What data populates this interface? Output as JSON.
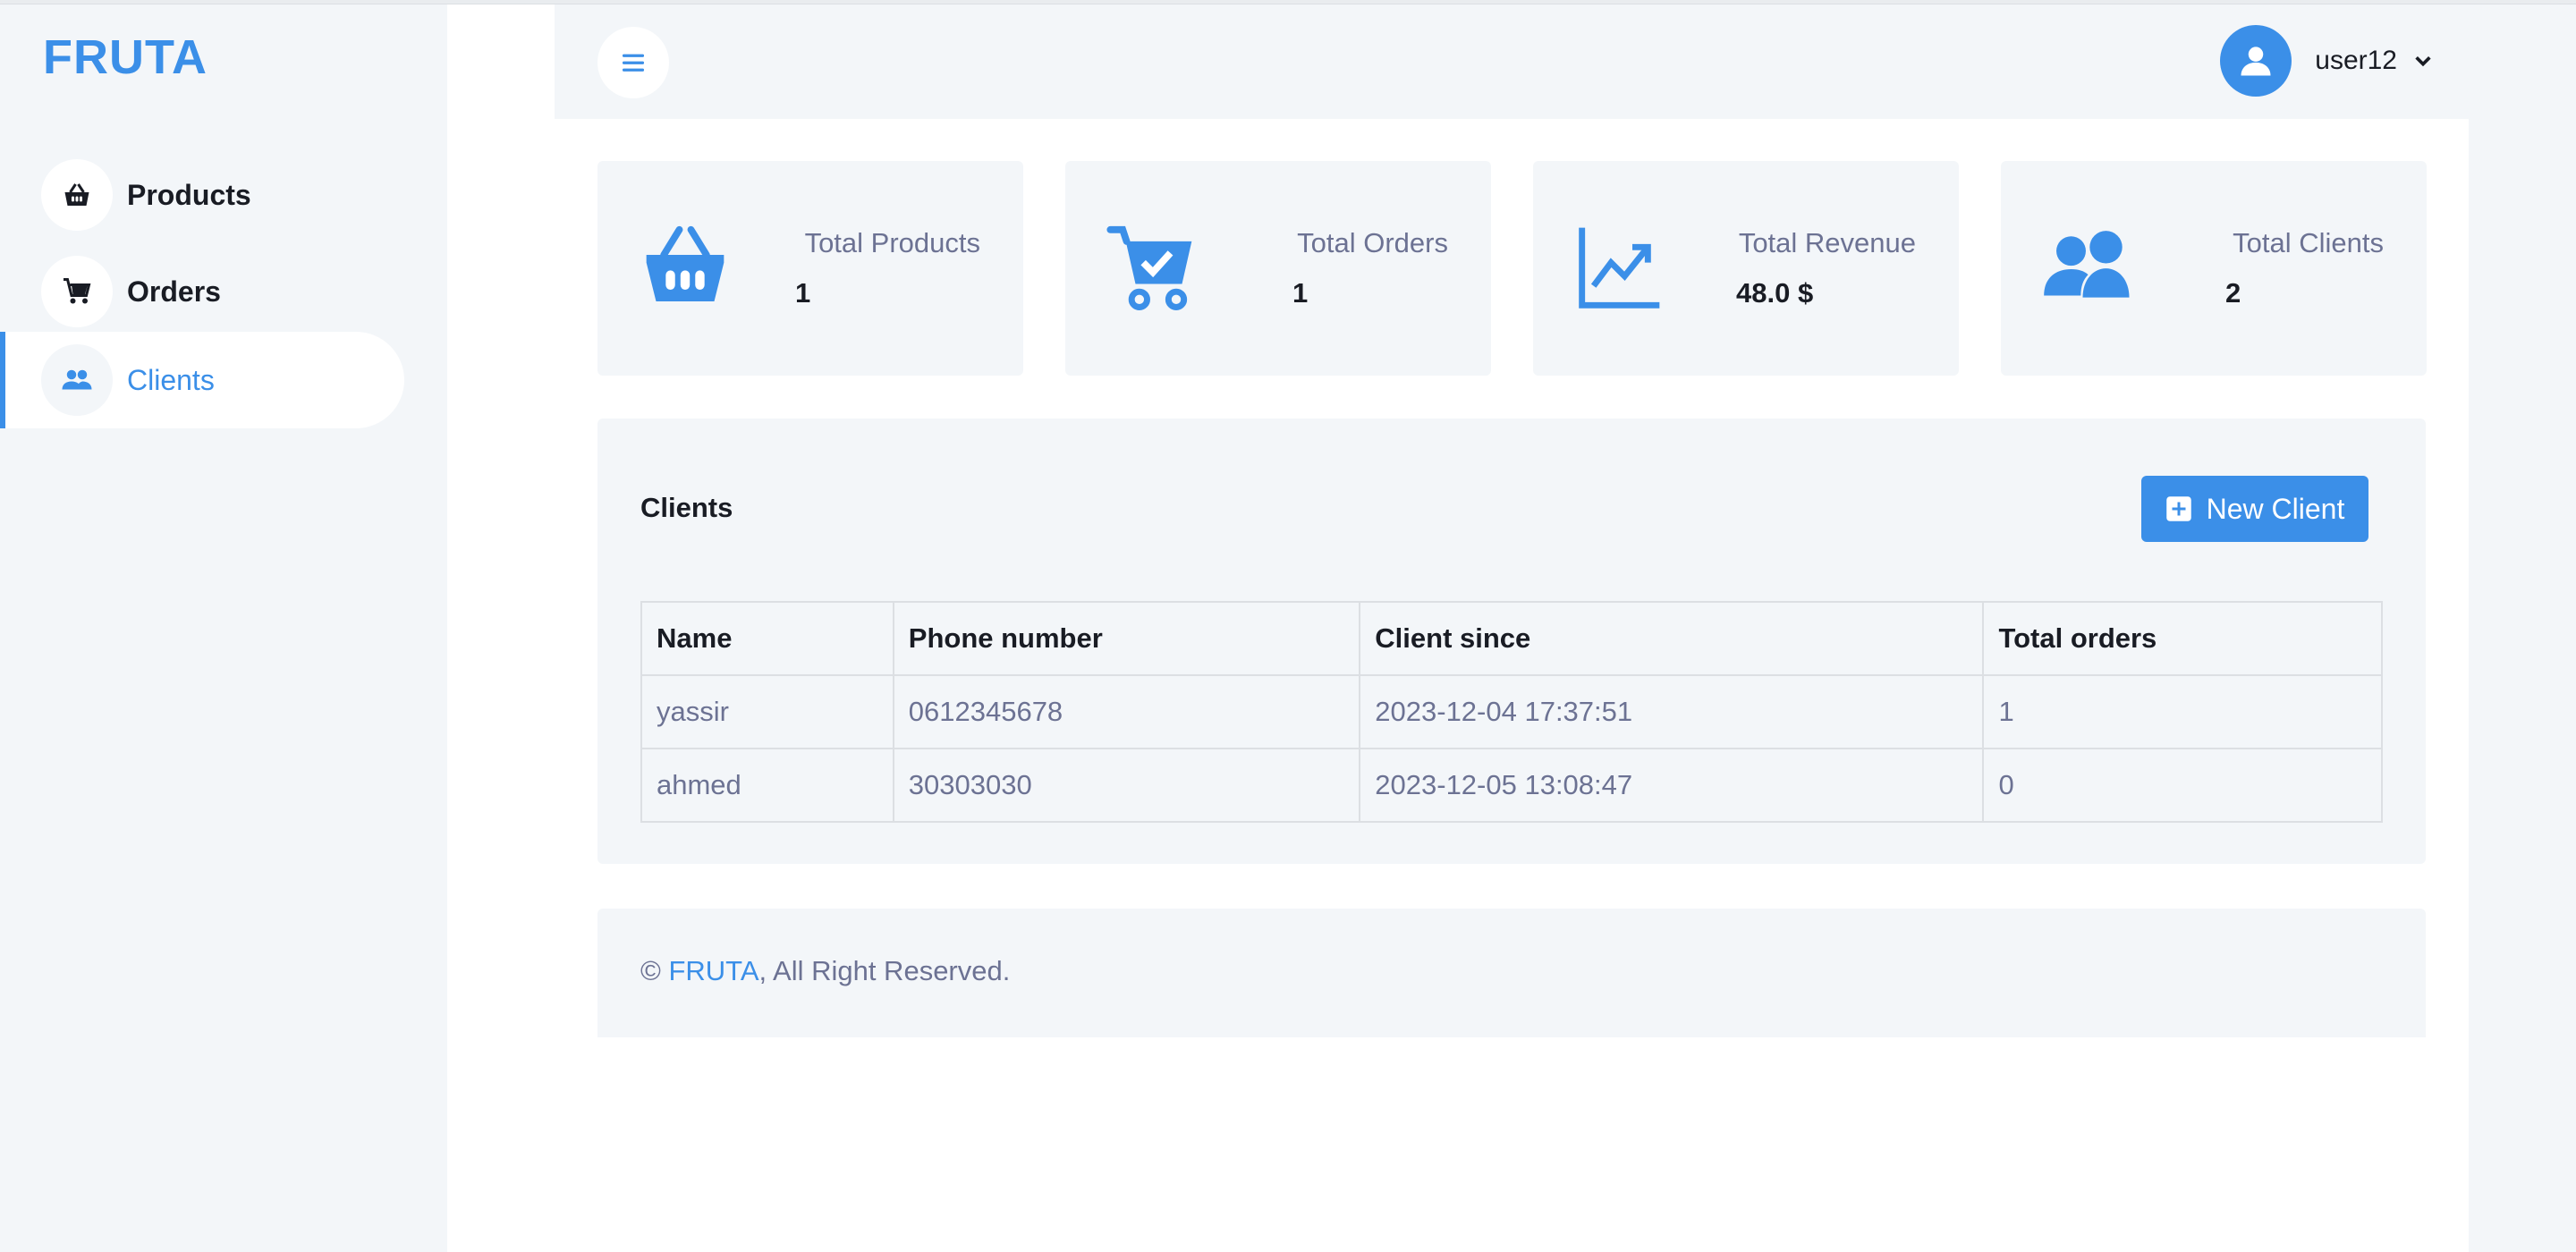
{
  "brand": "FRUTA",
  "sidebar": {
    "items": [
      {
        "label": "Products",
        "icon": "basket-icon",
        "active": false
      },
      {
        "label": "Orders",
        "icon": "cart-icon",
        "active": false
      },
      {
        "label": "Clients",
        "icon": "users-icon",
        "active": true
      }
    ]
  },
  "header": {
    "menu_icon": "hamburger-icon",
    "user_name": "user12"
  },
  "stats": [
    {
      "label": "Total Products",
      "value": "1",
      "icon": "basket-icon"
    },
    {
      "label": "Total Orders",
      "value": "1",
      "icon": "cart-check-icon"
    },
    {
      "label": "Total Revenue",
      "value": "48.0 $",
      "icon": "chart-line-icon"
    },
    {
      "label": "Total Clients",
      "value": "2",
      "icon": "users-icon"
    }
  ],
  "clients_panel": {
    "title": "Clients",
    "new_button_label": "New Client",
    "columns": [
      "Name",
      "Phone number",
      "Client since",
      "Total orders"
    ],
    "rows": [
      [
        "yassir",
        "0612345678",
        "2023-12-04 17:37:51",
        "1"
      ],
      [
        "ahmed",
        "30303030",
        "2023-12-05 13:08:47",
        "0"
      ]
    ]
  },
  "footer": {
    "copyright_symbol": "©",
    "brand_link": "FRUTA",
    "suffix": ", All Right Reserved."
  },
  "colors": {
    "accent": "#3b8fe8",
    "panel_bg": "#f3f6f9",
    "text_dark": "#191c24",
    "text_muted": "#6c7293"
  }
}
